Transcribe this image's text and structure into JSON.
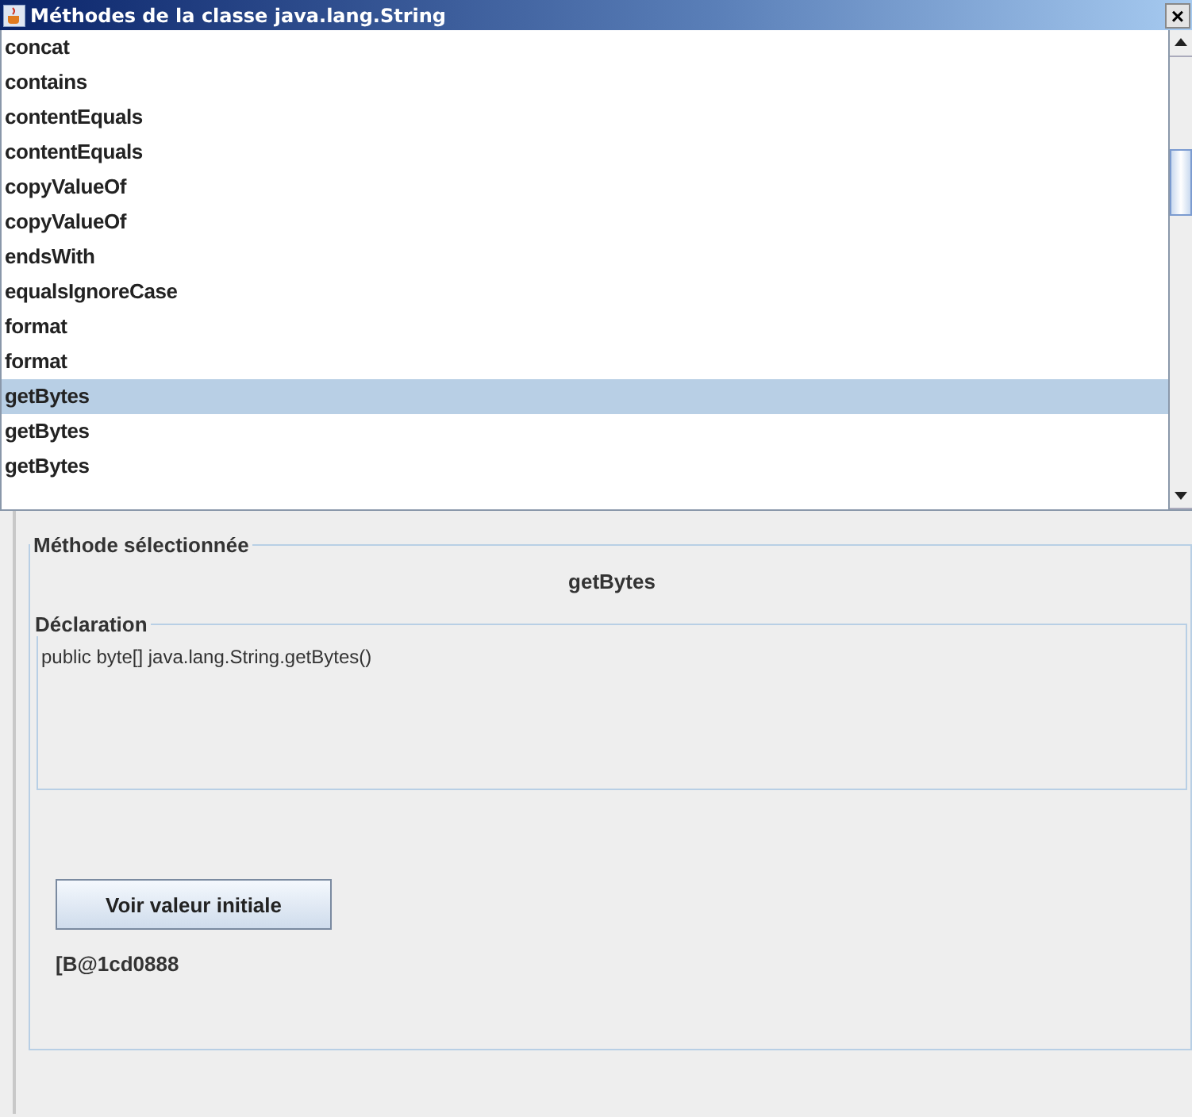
{
  "window": {
    "title": "Méthodes de la classe java.lang.String",
    "close": "×"
  },
  "methods": [
    {
      "label": "concat",
      "selected": false
    },
    {
      "label": "contains",
      "selected": false
    },
    {
      "label": "contentEquals",
      "selected": false
    },
    {
      "label": "contentEquals",
      "selected": false
    },
    {
      "label": "copyValueOf",
      "selected": false
    },
    {
      "label": "copyValueOf",
      "selected": false
    },
    {
      "label": "endsWith",
      "selected": false
    },
    {
      "label": "equalsIgnoreCase",
      "selected": false
    },
    {
      "label": "format",
      "selected": false
    },
    {
      "label": "format",
      "selected": false
    },
    {
      "label": "getBytes",
      "selected": true
    },
    {
      "label": "getBytes",
      "selected": false
    },
    {
      "label": "getBytes",
      "selected": false
    }
  ],
  "selected_panel": {
    "legend": "Méthode sélectionnée",
    "method_name": "getBytes",
    "declaration": {
      "legend": "Déclaration",
      "text": "public byte[] java.lang.String.getBytes()"
    },
    "button": "Voir valeur initiale",
    "result": "[B@1cd0888"
  }
}
